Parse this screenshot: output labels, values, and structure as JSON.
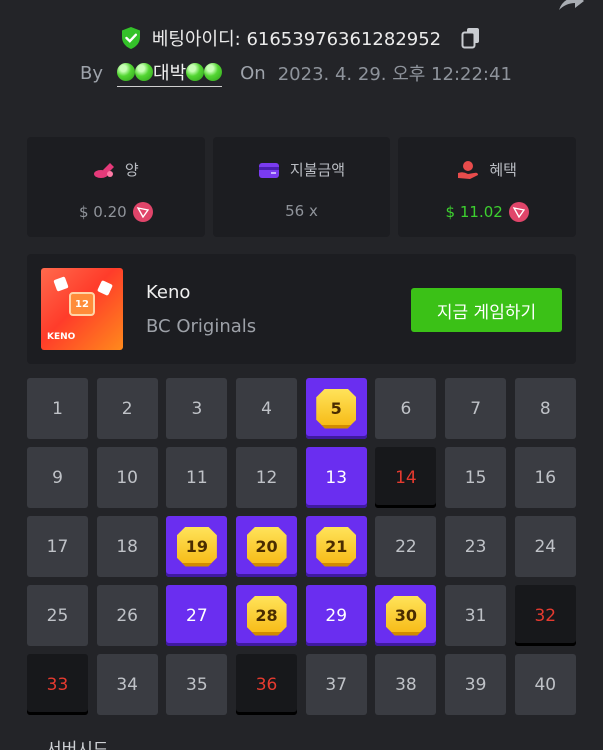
{
  "bet": {
    "id_label": "베팅아이디: 6165397636128 2952",
    "id_full": "베팅아이디: 6165397636 1282952"
  },
  "meta": {
    "by_label": "By",
    "user_name": "대박",
    "on_label": "On",
    "date": "2023. 4. 29. 오후 12:22:41"
  },
  "stats": [
    {
      "label": "양",
      "value": "$ 0.20",
      "icon": "coins-icon",
      "color": "#e53a7a"
    },
    {
      "label": "지불금액",
      "value": "56 x",
      "icon": "wallet-icon",
      "color": "#7a3bf0"
    },
    {
      "label": "혜택",
      "value": "$ 11.02",
      "icon": "hand-coin-icon",
      "color": "#e84c4c"
    }
  ],
  "game": {
    "name": "Keno",
    "provider": "BC Originals",
    "play_label": "지금 게임하기",
    "thumb_number": "12",
    "thumb_label": "KENO"
  },
  "cells": [
    {
      "n": "1",
      "s": "normal"
    },
    {
      "n": "2",
      "s": "normal"
    },
    {
      "n": "3",
      "s": "normal"
    },
    {
      "n": "4",
      "s": "normal"
    },
    {
      "n": "5",
      "s": "hit"
    },
    {
      "n": "6",
      "s": "normal"
    },
    {
      "n": "7",
      "s": "normal"
    },
    {
      "n": "8",
      "s": "normal"
    },
    {
      "n": "9",
      "s": "normal"
    },
    {
      "n": "10",
      "s": "normal"
    },
    {
      "n": "11",
      "s": "normal"
    },
    {
      "n": "12",
      "s": "normal"
    },
    {
      "n": "13",
      "s": "selected"
    },
    {
      "n": "14",
      "s": "miss"
    },
    {
      "n": "15",
      "s": "normal"
    },
    {
      "n": "16",
      "s": "normal"
    },
    {
      "n": "17",
      "s": "normal"
    },
    {
      "n": "18",
      "s": "normal"
    },
    {
      "n": "19",
      "s": "hit"
    },
    {
      "n": "20",
      "s": "hit"
    },
    {
      "n": "21",
      "s": "hit"
    },
    {
      "n": "22",
      "s": "normal"
    },
    {
      "n": "23",
      "s": "normal"
    },
    {
      "n": "24",
      "s": "normal"
    },
    {
      "n": "25",
      "s": "normal"
    },
    {
      "n": "26",
      "s": "normal"
    },
    {
      "n": "27",
      "s": "selected"
    },
    {
      "n": "28",
      "s": "hit"
    },
    {
      "n": "29",
      "s": "selected"
    },
    {
      "n": "30",
      "s": "hit"
    },
    {
      "n": "31",
      "s": "normal"
    },
    {
      "n": "32",
      "s": "miss"
    },
    {
      "n": "33",
      "s": "miss"
    },
    {
      "n": "34",
      "s": "normal"
    },
    {
      "n": "35",
      "s": "normal"
    },
    {
      "n": "36",
      "s": "miss"
    },
    {
      "n": "37",
      "s": "normal"
    },
    {
      "n": "38",
      "s": "normal"
    },
    {
      "n": "39",
      "s": "normal"
    },
    {
      "n": "40",
      "s": "normal"
    }
  ],
  "next_section_label": "서버시드"
}
